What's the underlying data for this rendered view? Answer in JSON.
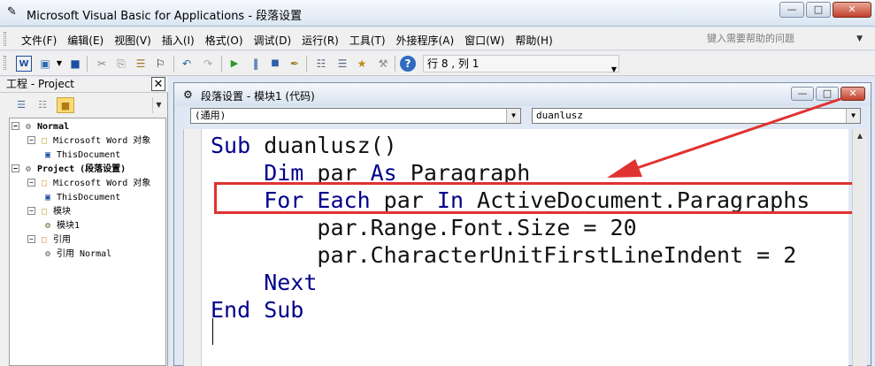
{
  "app": {
    "title": "Microsoft Visual Basic for Applications - 段落设置",
    "icon": "vba-icon"
  },
  "menu": {
    "items": [
      "文件(F)",
      "编辑(E)",
      "视图(V)",
      "插入(I)",
      "格式(O)",
      "调试(D)",
      "运行(R)",
      "工具(T)",
      "外接程序(A)",
      "窗口(W)",
      "帮助(H)"
    ],
    "help_placeholder": "键入需要帮助的问题"
  },
  "toolbar": {
    "position_text": "行 8 , 列 1"
  },
  "project": {
    "title": "工程 - Project",
    "tree": [
      {
        "label": "Normal",
        "icon": "vba-project-icon",
        "expander": "−",
        "bold": true
      },
      {
        "label": "Microsoft Word 对象",
        "icon": "folder-icon",
        "expander": "−",
        "bold": false
      },
      {
        "label": "ThisDocument",
        "icon": "word-doc-icon",
        "expander": "",
        "bold": false
      },
      {
        "label": "Project (段落设置)",
        "icon": "vba-project-icon",
        "expander": "−",
        "bold": true
      },
      {
        "label": "Microsoft Word 对象",
        "icon": "folder-icon",
        "expander": "−",
        "bold": false
      },
      {
        "label": "ThisDocument",
        "icon": "word-doc-icon",
        "expander": "",
        "bold": false
      },
      {
        "label": "模块",
        "icon": "folder-icon",
        "expander": "−",
        "bold": false
      },
      {
        "label": "模块1",
        "icon": "module-icon",
        "expander": "",
        "bold": false
      },
      {
        "label": "引用",
        "icon": "folder-icon",
        "expander": "−",
        "bold": false
      },
      {
        "label": "引用 Normal",
        "icon": "reference-icon",
        "expander": "",
        "bold": false
      }
    ]
  },
  "code_window": {
    "title": "段落设置 - 模块1 (代码)",
    "object_combo": "(通用)",
    "proc_combo": "duanlusz",
    "lines": [
      [
        {
          "t": "Sub",
          "k": 1
        },
        {
          "t": " duanlusz()",
          "k": 0
        }
      ],
      [
        {
          "t": "    Dim",
          "k": 1
        },
        {
          "t": " par ",
          "k": 0
        },
        {
          "t": "As",
          "k": 1
        },
        {
          "t": " Paragraph",
          "k": 0
        }
      ],
      [
        {
          "t": "    For Each",
          "k": 1
        },
        {
          "t": " par ",
          "k": 0
        },
        {
          "t": "In",
          "k": 1
        },
        {
          "t": " ActiveDocument.Paragraphs",
          "k": 0
        }
      ],
      [
        {
          "t": "        par.Range.Font.Size = 20",
          "k": 0
        }
      ],
      [
        {
          "t": "        par.CharacterUnitFirstLineIndent = 2",
          "k": 0
        }
      ],
      [
        {
          "t": "    Next",
          "k": 1
        }
      ],
      [
        {
          "t": "End Sub",
          "k": 1
        }
      ]
    ]
  },
  "annotation": {
    "highlight_color": "#e03232"
  }
}
